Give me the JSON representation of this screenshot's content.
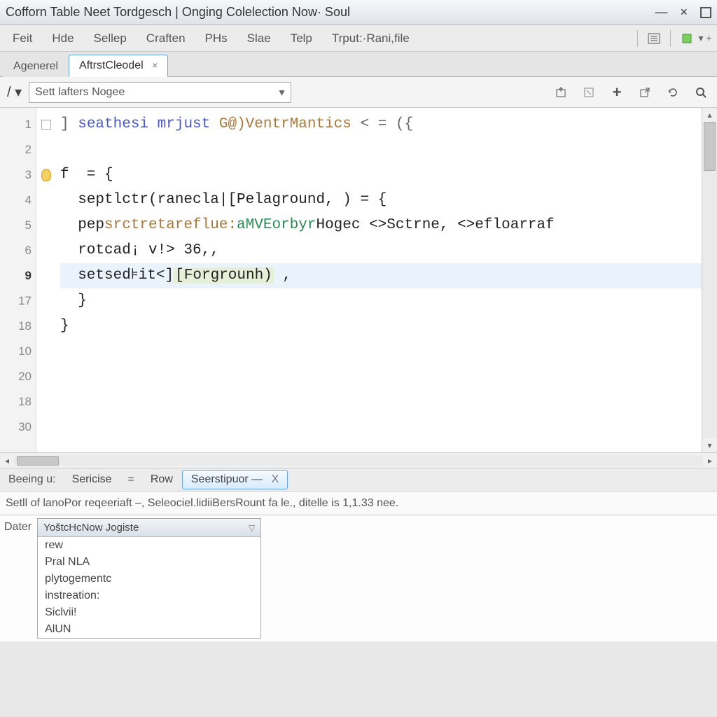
{
  "window": {
    "title": "Cofforn Table Neet Tordgesch | Onging Colelection Now· Soul"
  },
  "menu": {
    "items": [
      "Feit",
      "Hde",
      "Sellep",
      "Craften",
      "PHs",
      "Slae",
      "Telp",
      "Trput:·Rani,file"
    ]
  },
  "tabs": {
    "first": "Agenerel",
    "active": "AftrstCleodel",
    "close": "×"
  },
  "combo": {
    "value": "Sett lafters Nogee"
  },
  "gutter": {
    "lines": [
      "1",
      "2",
      "3",
      "4",
      "5",
      "6",
      "9",
      "17",
      "18",
      "10",
      "20",
      "18",
      "30"
    ]
  },
  "code": {
    "l1a": "] ",
    "l1b": "seathesi mrjust ",
    "l1c": "G@)VentrMantics",
    "l1d": " < = ({",
    "l3": "f  = {",
    "l4": "  septlctr(ranecla|[Pelaground, ) = {",
    "l5a": "  pep",
    "l5b": "srctretareflue:",
    "l5c": "aMVEorbyr",
    "l5d": "Hogec <>Sctrne, <>efloarraf",
    "l6": "  rotcad¡ v!> 36,,",
    "l7a": "  setsed⊧it<]",
    "l7b": "[Forgrounh)",
    "l7c": " ,",
    "l8": "  }",
    "l9": "}"
  },
  "bottom": {
    "seg1": "Beeing u:",
    "seg2": "Sericise",
    "eq": "=",
    "seg3": "Row",
    "active": "Seerstipuor  —",
    "close": "X"
  },
  "status": {
    "text": "Setll of lanoPor reqeeriaft –, Seleociel.lidiiBersRount fa le., ditelle is 1,1.33 nee."
  },
  "panel": {
    "label": "Dater",
    "header": "YoštcHcNow Jogiste",
    "items": [
      "rew",
      "Pral NLA",
      "plytogementc",
      "instreation:",
      "Siclvii!",
      "AlUN"
    ]
  }
}
